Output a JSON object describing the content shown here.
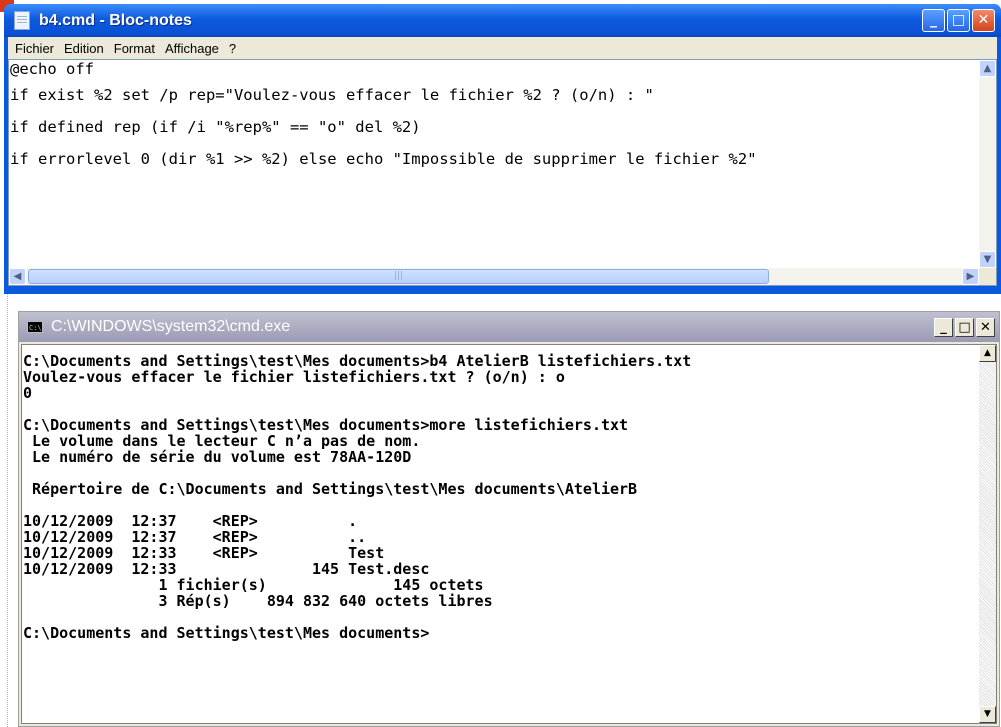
{
  "notepad": {
    "title": "b4.cmd - Bloc-notes",
    "menu": [
      "Fichier",
      "Edition",
      "Format",
      "Affichage",
      "?"
    ],
    "lines": [
      "@echo off",
      "if exist %2 set /p rep=\"Voulez-vous effacer le fichier %2 ? (o/n) : \"",
      "if defined rep (if /i \"%rep%\" == \"o\" del %2)",
      "if errorlevel 0 (dir %1 >> %2) else echo \"Impossible de supprimer le fichier %2\""
    ]
  },
  "cmd": {
    "title": "C:\\WINDOWS\\system32\\cmd.exe",
    "lines": [
      "C:\\Documents and Settings\\test\\Mes documents>b4 AtelierB listefichiers.txt",
      "Voulez-vous effacer le fichier listefichiers.txt ? (o/n) : o",
      "0",
      "",
      "C:\\Documents and Settings\\test\\Mes documents>more listefichiers.txt",
      " Le volume dans le lecteur C n’a pas de nom.",
      " Le numéro de série du volume est 78AA-120D",
      "",
      " Répertoire de C:\\Documents and Settings\\test\\Mes documents\\AtelierB",
      "",
      "10/12/2009  12:37    <REP>          .",
      "10/12/2009  12:37    <REP>          ..",
      "10/12/2009  12:33    <REP>          Test",
      "10/12/2009  12:33               145 Test.desc",
      "               1 fichier(s)              145 octets",
      "               3 Rép(s)    894 832 640 octets libres",
      "",
      "C:\\Documents and Settings\\test\\Mes documents>"
    ]
  }
}
